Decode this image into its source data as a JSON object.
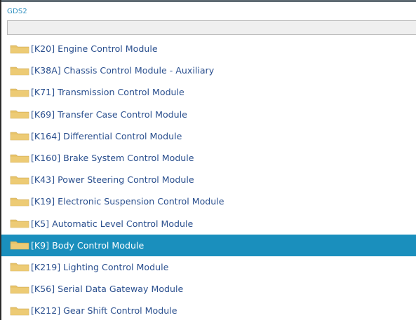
{
  "window": {
    "title": "GDS2"
  },
  "filter": {
    "value": "",
    "placeholder": ""
  },
  "colors": {
    "accent": "#1a8fbd",
    "folder": "#e8c46a",
    "label": "#2a4f8e",
    "title": "#2f8fbf"
  },
  "modules": [
    {
      "label": "[K20] Engine Control Module",
      "selected": false
    },
    {
      "label": "[K38A] Chassis Control Module - Auxiliary",
      "selected": false
    },
    {
      "label": "[K71] Transmission Control Module",
      "selected": false
    },
    {
      "label": "[K69] Transfer Case Control Module",
      "selected": false
    },
    {
      "label": "[K164] Differential Control Module",
      "selected": false
    },
    {
      "label": "[K160] Brake System Control Module",
      "selected": false
    },
    {
      "label": "[K43] Power Steering Control Module",
      "selected": false
    },
    {
      "label": "[K19] Electronic Suspension Control Module",
      "selected": false
    },
    {
      "label": "[K5] Automatic Level Control Module",
      "selected": false
    },
    {
      "label": "[K9] Body Control Module",
      "selected": true
    },
    {
      "label": "[K219] Lighting Control Module",
      "selected": false
    },
    {
      "label": "[K56] Serial Data Gateway Module",
      "selected": false
    },
    {
      "label": "[K212] Gear Shift Control Module",
      "selected": false
    }
  ]
}
